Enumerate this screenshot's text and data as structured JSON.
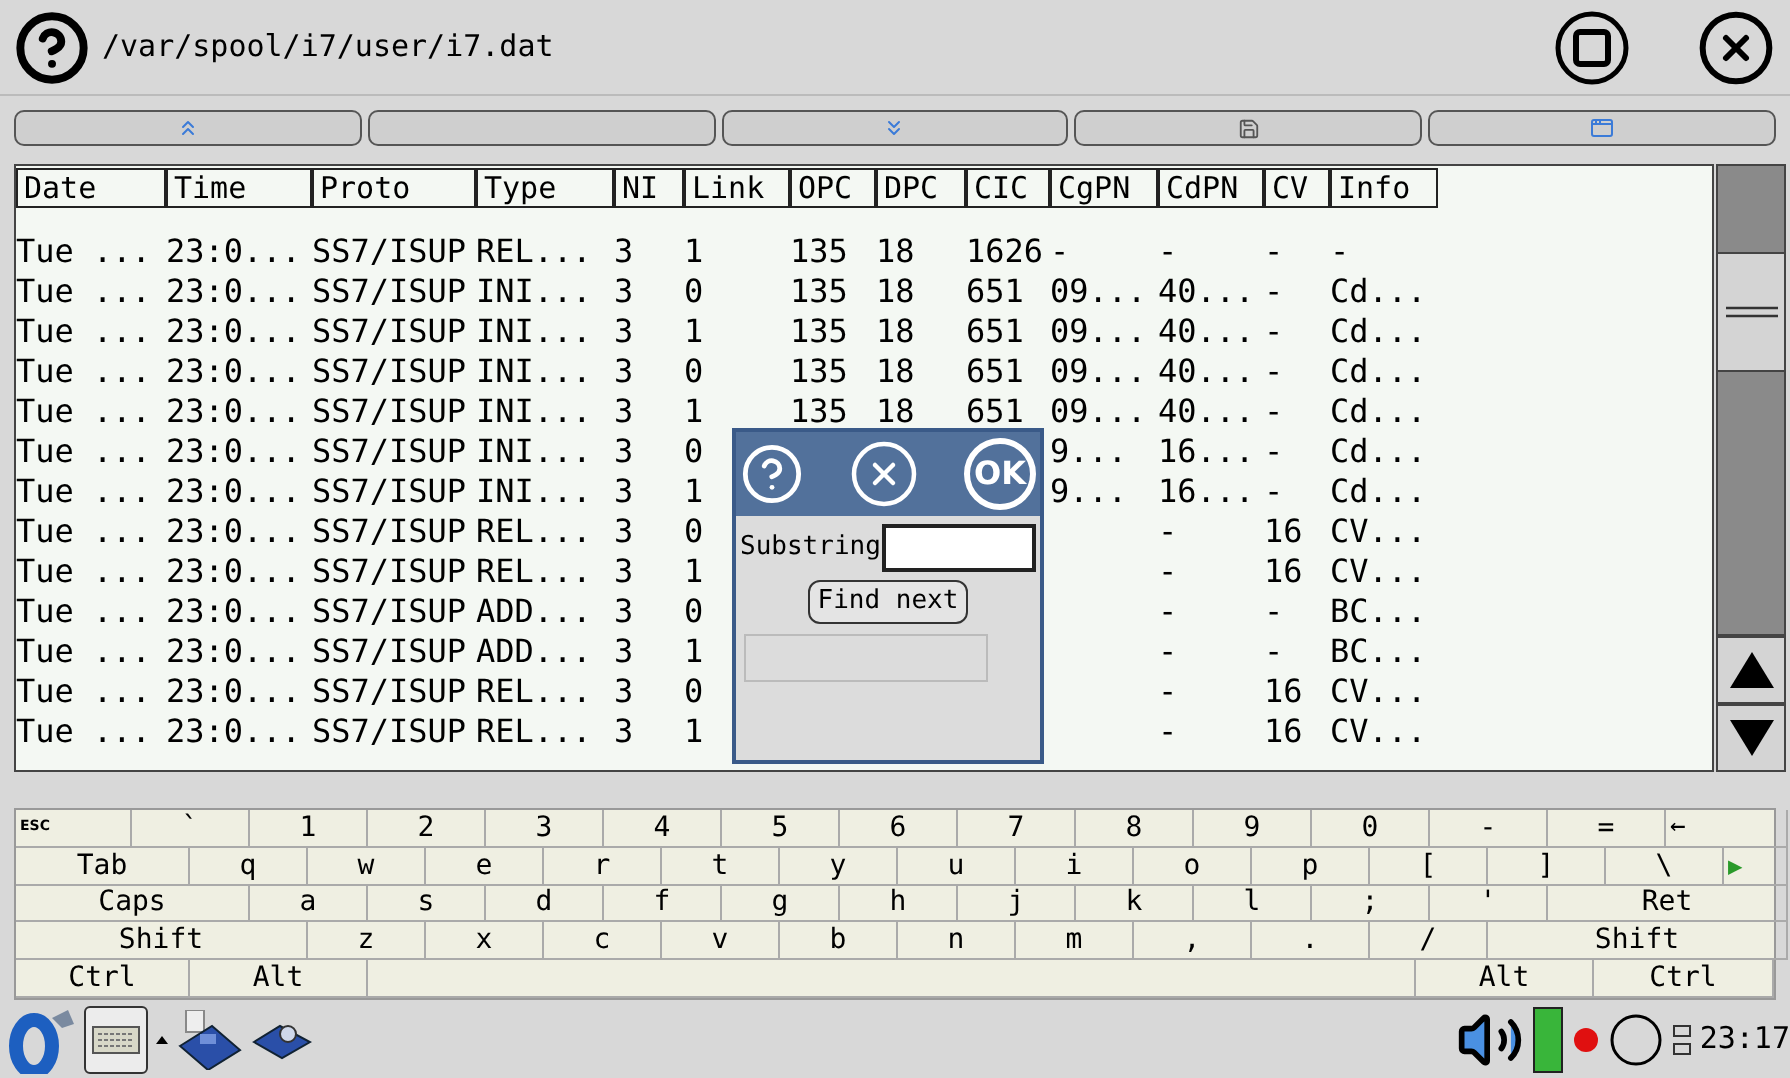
{
  "window": {
    "title": "/var/spool/i7/user/i7.dat"
  },
  "toolbar": [
    {
      "kind": "up"
    },
    {
      "kind": "blank"
    },
    {
      "kind": "down"
    },
    {
      "kind": "save"
    },
    {
      "kind": "window"
    }
  ],
  "table": {
    "columns": [
      "Date",
      "Time",
      "Proto",
      "Type",
      "NI",
      "Link",
      "OPC",
      "DPC",
      "CIC",
      "CgPN",
      "CdPN",
      "CV",
      "Info"
    ],
    "rows": [
      [
        "Tue ...",
        "23:0...",
        "SS7/ISUP",
        "REL...",
        "3",
        "1",
        "135",
        "18",
        "1626",
        "-",
        "-",
        "-",
        "-"
      ],
      [
        "Tue ...",
        "23:0...",
        "SS7/ISUP",
        "INI...",
        "3",
        "0",
        "135",
        "18",
        "651",
        "09...",
        "40...",
        "-",
        "Cd..."
      ],
      [
        "Tue ...",
        "23:0...",
        "SS7/ISUP",
        "INI...",
        "3",
        "1",
        "135",
        "18",
        "651",
        "09...",
        "40...",
        "-",
        "Cd..."
      ],
      [
        "Tue ...",
        "23:0...",
        "SS7/ISUP",
        "INI...",
        "3",
        "0",
        "135",
        "18",
        "651",
        "09...",
        "40...",
        "-",
        "Cd..."
      ],
      [
        "Tue ...",
        "23:0...",
        "SS7/ISUP",
        "INI...",
        "3",
        "1",
        "135",
        "18",
        "651",
        "09...",
        "40...",
        "-",
        "Cd..."
      ],
      [
        "Tue ...",
        "23:0...",
        "SS7/ISUP",
        "INI...",
        "3",
        "0",
        null,
        null,
        null,
        "9...",
        "16...",
        "-",
        "Cd..."
      ],
      [
        "Tue ...",
        "23:0...",
        "SS7/ISUP",
        "INI...",
        "3",
        "1",
        null,
        null,
        null,
        "9...",
        "16...",
        "-",
        "Cd..."
      ],
      [
        "Tue ...",
        "23:0...",
        "SS7/ISUP",
        "REL...",
        "3",
        "0",
        null,
        null,
        null,
        null,
        "-",
        "16",
        "CV..."
      ],
      [
        "Tue ...",
        "23:0...",
        "SS7/ISUP",
        "REL...",
        "3",
        "1",
        null,
        null,
        null,
        null,
        "-",
        "16",
        "CV..."
      ],
      [
        "Tue ...",
        "23:0...",
        "SS7/ISUP",
        "ADD...",
        "3",
        "0",
        null,
        null,
        null,
        null,
        "-",
        "-",
        "BC..."
      ],
      [
        "Tue ...",
        "23:0...",
        "SS7/ISUP",
        "ADD...",
        "3",
        "1",
        null,
        null,
        null,
        null,
        "-",
        "-",
        "BC..."
      ],
      [
        "Tue ...",
        "23:0...",
        "SS7/ISUP",
        "REL...",
        "3",
        "0",
        null,
        null,
        null,
        null,
        "-",
        "16",
        "CV..."
      ],
      [
        "Tue ...",
        "23:0...",
        "SS7/ISUP",
        "REL...",
        "3",
        "1",
        null,
        null,
        null,
        null,
        "-",
        "16",
        "CV..."
      ]
    ]
  },
  "dialog": {
    "label": "Substring",
    "button": "Find next",
    "ok": "OK"
  },
  "keyboard": {
    "rows": [
      {
        "keys": [
          "ESC",
          "`",
          "1",
          "2",
          "3",
          "4",
          "5",
          "6",
          "7",
          "8",
          "9",
          "0",
          "-",
          "=",
          "←"
        ]
      },
      {
        "keys": [
          "Tab",
          "q",
          "w",
          "e",
          "r",
          "t",
          "y",
          "u",
          "i",
          "o",
          "p",
          "[",
          "]",
          "\\",
          "▶"
        ]
      },
      {
        "keys": [
          "Caps",
          "a",
          "s",
          "d",
          "f",
          "g",
          "h",
          "j",
          "k",
          "l",
          ";",
          "'",
          "Ret"
        ]
      },
      {
        "keys": [
          "Shift",
          "z",
          "x",
          "c",
          "v",
          "b",
          "n",
          "m",
          ",",
          ".",
          "/",
          "Shift"
        ]
      }
    ],
    "bottom_left": [
      "Ctrl",
      "Alt"
    ],
    "bottom_right": [
      "Alt",
      "Ctrl"
    ]
  },
  "taskbar": {
    "clock": "23:17"
  }
}
